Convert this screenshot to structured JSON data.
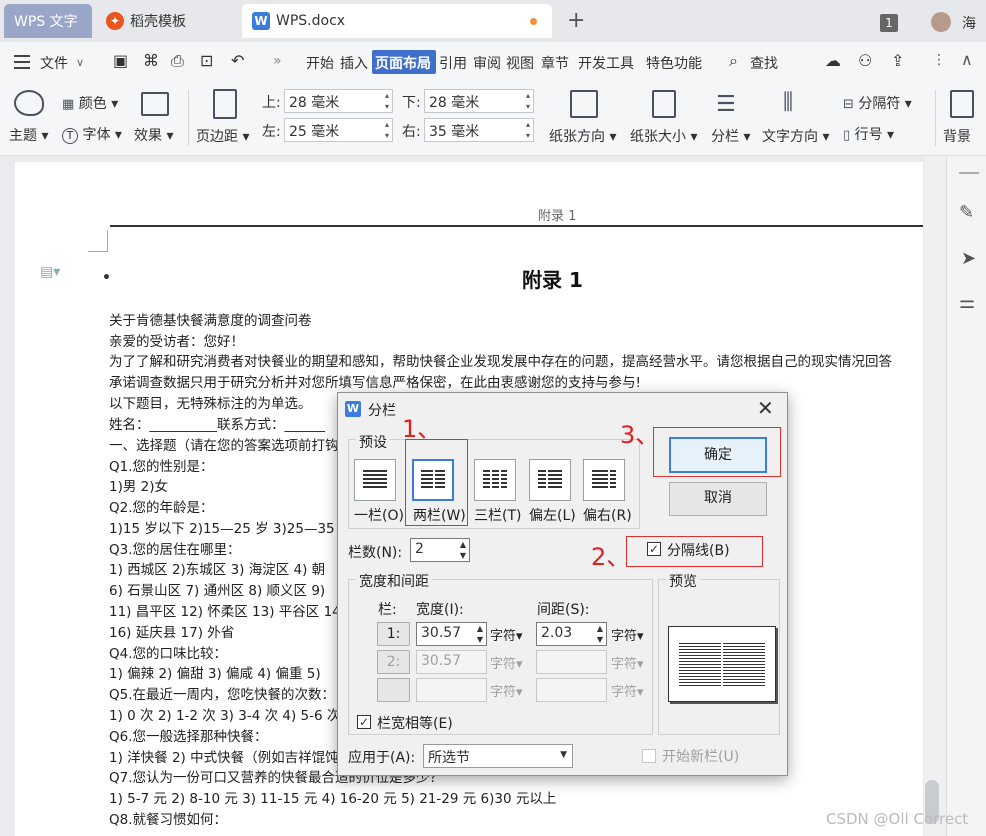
{
  "tabs": [
    {
      "label": "WPS 文字"
    },
    {
      "label": "稻壳模板"
    },
    {
      "label": "WPS.docx"
    }
  ],
  "window": {
    "badge": "1",
    "user": "海"
  },
  "menu": [
    "文件",
    "开始",
    "插入",
    "页面布局",
    "引用",
    "审阅",
    "视图",
    "章节",
    "开发工具",
    "特色功能"
  ],
  "search_label": "查找",
  "ribbon": {
    "theme": "主题",
    "colors": "颜色",
    "font": "字体",
    "effects": "效果",
    "margins": "页边距",
    "top_label": "上:",
    "top_value": "28 毫米",
    "bottom_label": "下:",
    "bottom_value": "28 毫米",
    "left_label": "左:",
    "left_value": "25 毫米",
    "right_label": "右:",
    "right_value": "35 毫米",
    "orientation": "纸张方向",
    "size": "纸张大小",
    "columns": "分栏",
    "text_direction": "文字方向",
    "separator": "分隔符",
    "line_numbers": "行号",
    "background": "背景"
  },
  "document": {
    "header": "附录 1",
    "title": "附录 1",
    "lines": [
      "关于肯德基快餐满意度的调查问卷",
      "亲爱的受访者：您好！",
      "为了了解和研究消费者对快餐业的期望和感知，帮助快餐企业发现发展中存在的问题，提高经营水平。请您根据自己的现实情况回答",
      "承诺调查数据只用于研究分析并对您所填写信息严格保密，在此由衷感谢您的支持与参与!",
      "以下题目，无特殊标注的为单选。",
      "姓名：__________联系方式：______",
      "一、选择题（请在您的答案选项前打钩",
      "Q1.您的性别是：",
      "1)男 2)女",
      "Q2.您的年龄是：",
      "1)15 岁以下 2)15—25 岁 3)25—35 4)3",
      "Q3.您的居住在哪里：",
      "1) 西城区 2)东城区 3) 海淀区 4) 朝",
      "6) 石景山区 7) 通州区 8) 顺义区 9)",
      "11) 昌平区 12) 怀柔区 13) 平谷区 14",
      "16) 延庆县 17) 外省",
      "Q4.您的口味比较：",
      "1) 偏辣 2) 偏甜 3) 偏咸 4) 偏重 5)",
      "Q5.在最近一周内，您吃快餐的次数：",
      "1) 0 次 2) 1-2 次 3) 3-4 次 4) 5-6 次",
      "Q6.您一般选择那种快餐：",
      "1) 洋快餐 2) 中式快餐（例如吉祥馄饨",
      "Q7.您认为一份可口又营养的快餐最合适的价位是多少？",
      "1) 5-7 元 2) 8-10 元 3) 11-15 元 4) 16-20 元 5) 21-29 元 6)30 元以上",
      "Q8.就餐习惯如何："
    ]
  },
  "dialog": {
    "title": "分栏",
    "presets_label": "预设",
    "presets": [
      "一栏(O)",
      "两栏(W)",
      "三栏(T)",
      "偏左(L)",
      "偏右(R)"
    ],
    "ok": "确定",
    "cancel": "取消",
    "col_count_label": "栏数(N):",
    "col_count": "2",
    "separator_line": "分隔线(B)",
    "width_spacing_label": "宽度和间距",
    "col_header": "栏:",
    "width_header": "宽度(I):",
    "spacing_header": "间距(S):",
    "rows": [
      {
        "num": "1:",
        "width": "30.57",
        "spacing": "2.03",
        "unit": "字符"
      },
      {
        "num": "2:",
        "width": "30.57",
        "spacing": "",
        "unit": "字符"
      },
      {
        "num": "",
        "width": "",
        "spacing": "",
        "unit": "字符"
      }
    ],
    "equal_width": "栏宽相等(E)",
    "apply_to_label": "应用于(A):",
    "apply_to": "所选节",
    "new_column": "开始新栏(U)",
    "preview_label": "预览"
  },
  "annotations": {
    "n1": "1、",
    "n2": "2、",
    "n3": "3、"
  },
  "watermark": "CSDN @Oll Correct"
}
